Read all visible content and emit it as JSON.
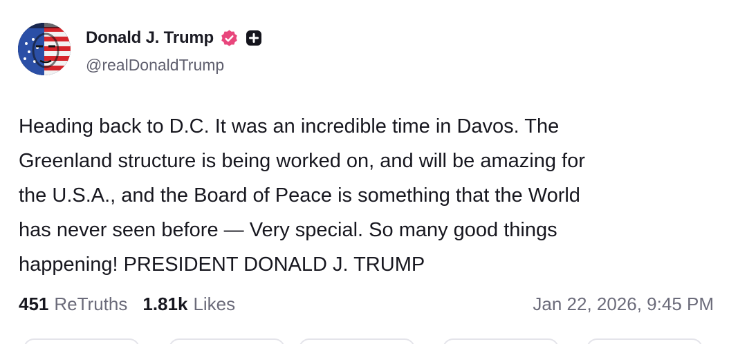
{
  "user": {
    "display_name": "Donald J. Trump",
    "handle": "@realDonaldTrump",
    "verified_badge_icon": "verified-badge-icon",
    "plus_badge_icon": "plus-badge-icon",
    "verified_color": "#e8467c"
  },
  "post": {
    "text": "Heading back to D.C. It was an incredible time in Davos. The\nGreenland structure is being worked on, and will be amazing for\nthe U.S.A., and the Board of Peace is something that the World\nhas never seen before — Very special. So many good things\nhappening! PRESIDENT DONALD J. TRUMP",
    "retruths_count": "451",
    "retruths_label": "ReTruths",
    "likes_count": "1.81k",
    "likes_label": "Likes",
    "timestamp": "Jan 22, 2026, 9:45 PM"
  }
}
